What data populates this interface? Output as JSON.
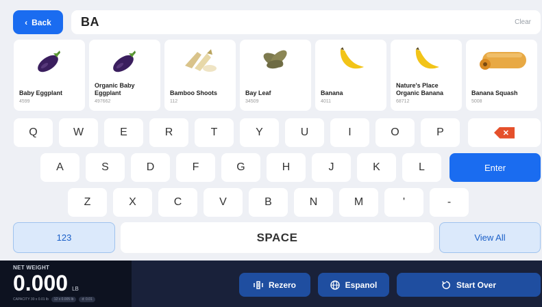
{
  "header": {
    "back_label": "Back",
    "search_value": "BA",
    "clear_label": "Clear"
  },
  "products": [
    {
      "name": "Baby Eggplant",
      "code": "4599",
      "icon": "eggplant-icon"
    },
    {
      "name": "Organic Baby Eggplant",
      "code": "497662",
      "icon": "eggplant-icon"
    },
    {
      "name": "Bamboo Shoots",
      "code": "112",
      "icon": "bamboo-shoots-icon"
    },
    {
      "name": "Bay Leaf",
      "code": "34509",
      "icon": "bay-leaf-icon"
    },
    {
      "name": "Banana",
      "code": "4011",
      "icon": "banana-icon"
    },
    {
      "name": "Nature's Place Organic Banana",
      "code": "68712",
      "icon": "banana-icon"
    },
    {
      "name": "Banana Squash",
      "code": "5008",
      "icon": "squash-icon"
    }
  ],
  "keyboard": {
    "row1": [
      "Q",
      "W",
      "E",
      "R",
      "T",
      "Y",
      "U",
      "I",
      "O",
      "P"
    ],
    "row2": [
      "A",
      "S",
      "D",
      "F",
      "G",
      "H",
      "J",
      "K",
      "L"
    ],
    "row3": [
      "Z",
      "X",
      "C",
      "V",
      "B",
      "N",
      "M",
      "'",
      "-"
    ],
    "enter_label": "Enter",
    "numbers_label": "123",
    "space_label": "SPACE",
    "view_all_label": "View All"
  },
  "scale": {
    "title": "NET WEIGHT",
    "value": "0.000",
    "unit": "LB",
    "capacity_text": "CAPACITY 30 x 0.01 lb",
    "pill_1": "12 x 0.005 lb",
    "pill_2": "d: 0.01"
  },
  "actions": {
    "rezero_label": "Rezero",
    "espanol_label": "Espanol",
    "start_over_label": "Start Over"
  },
  "colors": {
    "accent": "#1a6cf0",
    "backspace": "#e5502b",
    "bottom_bar": "#19213a",
    "action_button": "#1f4ea0"
  }
}
